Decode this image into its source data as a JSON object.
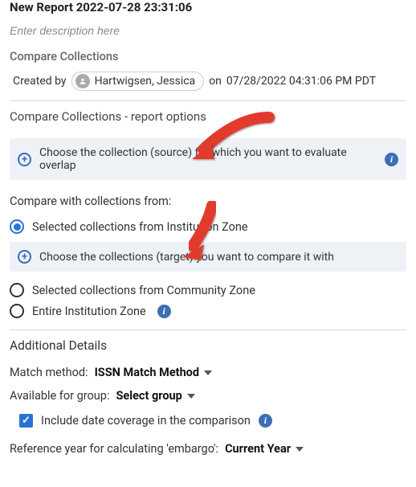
{
  "title": "New Report 2022-07-28 23:31:06",
  "description_placeholder": "Enter description here",
  "compare_collections_label": "Compare Collections",
  "created": {
    "by_label": "Created by",
    "user": "Hartwigsen, Jessica",
    "on_label": "on",
    "timestamp": "07/28/2022 04:31:06 PM PDT"
  },
  "options_heading": "Compare Collections - report options",
  "choose_source_text": "Choose the collection (source) for which you want to evaluate overlap",
  "compare_from_label": "Compare with collections from:",
  "radio_options": {
    "institution": "Selected collections from Institution Zone",
    "community": "Selected collections from Community Zone",
    "entire": "Entire Institution Zone"
  },
  "choose_target_text": "Choose the collections (target) you want to compare it with",
  "additional_heading": "Additional Details",
  "match_method": {
    "label": "Match method:",
    "value": "ISSN Match Method"
  },
  "available_group": {
    "label": "Available for group:",
    "value": "Select group"
  },
  "include_date_label": "Include date coverage in the comparison",
  "reference_year": {
    "label": "Reference year for calculating 'embargo':",
    "value": "Current Year"
  }
}
